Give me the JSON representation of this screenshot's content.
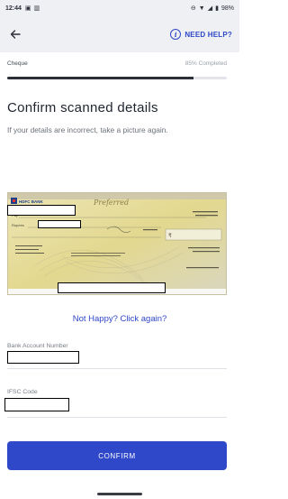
{
  "status_bar": {
    "time": "12:44",
    "left_icons": [
      "gallery-icon",
      "signal-icon"
    ],
    "battery": "98%"
  },
  "header": {
    "help_label": "NEED HELP?"
  },
  "progress": {
    "step_label": "Cheque",
    "percent_label": "85% Completed",
    "fraction": 0.85
  },
  "page": {
    "title": "Confirm scanned details",
    "subtitle": "If your details are incorrect, take a picture again."
  },
  "cheque": {
    "bank": "HDFC BANK",
    "pay_label": "Pay",
    "rupees_label": "Rupees",
    "rupee_symbol": "₹"
  },
  "retake_link": "Not Happy? Click again?",
  "fields": {
    "account_label": "Bank Account Number",
    "ifsc_label": "IFSC Code"
  },
  "confirm_button": "CONFIRM",
  "colors": {
    "accent": "#2f47c9",
    "cheque_paper": "#e6dc9a"
  }
}
